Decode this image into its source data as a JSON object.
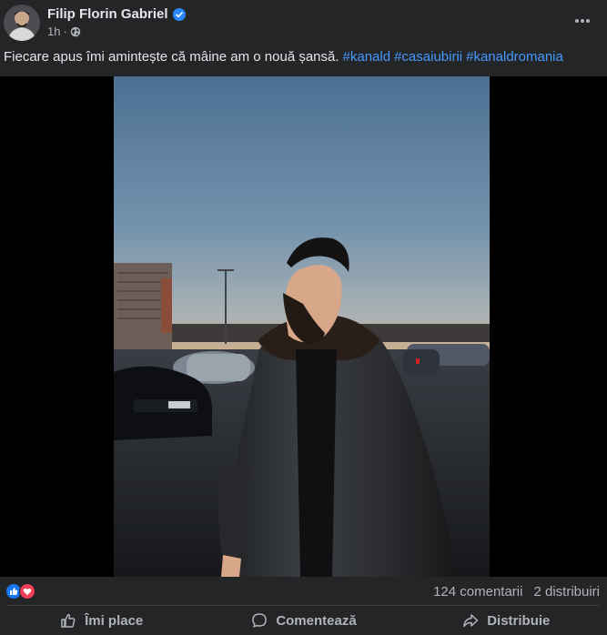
{
  "post": {
    "author": "Filip Florin Gabriel",
    "verified": true,
    "time": "1h",
    "separator": "·",
    "audience_icon": "globe-icon",
    "more_icon": "more-options-icon",
    "caption_text": "Fiecare apus îmi amintește că mâine am o nouă șansă.",
    "hashtags": [
      "#kanald",
      "#casaiubirii",
      "#kanaldromania"
    ]
  },
  "summary": {
    "reactions": [
      "like",
      "love"
    ],
    "comments": "124 comentarii",
    "shares": "2 distribuiri"
  },
  "actions": {
    "like": "Îmi place",
    "comment": "Comentează",
    "share": "Distribuie"
  },
  "colors": {
    "background": "#242526",
    "text_primary": "#e4e6eb",
    "text_secondary": "#b0b3b8",
    "link": "#4599ff",
    "verified": "#2d88ff",
    "like": "#1877f2",
    "love": "#f33e58"
  }
}
